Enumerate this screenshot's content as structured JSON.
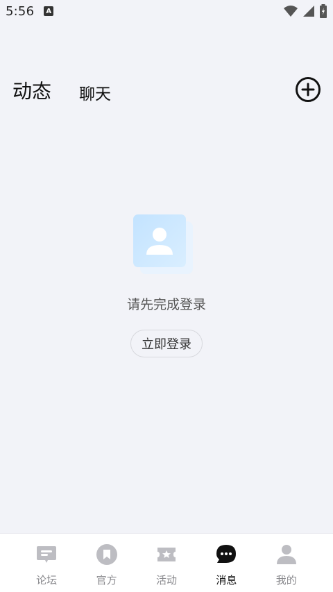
{
  "status_bar": {
    "time": "5:56",
    "badge": "A"
  },
  "header": {
    "tabs": [
      {
        "label": "动态",
        "active": true
      },
      {
        "label": "聊天",
        "active": false
      }
    ],
    "add_icon": "plus-circle-icon"
  },
  "empty_state": {
    "illustration": "user-card-icon",
    "message": "请先完成登录",
    "login_button": "立即登录"
  },
  "bottom_nav": {
    "items": [
      {
        "label": "论坛",
        "icon": "forum-icon",
        "active": false
      },
      {
        "label": "官方",
        "icon": "bookmark-icon",
        "active": false
      },
      {
        "label": "活动",
        "icon": "ticket-star-icon",
        "active": false
      },
      {
        "label": "消息",
        "icon": "chat-bubble-icon",
        "active": true
      },
      {
        "label": "我的",
        "icon": "person-icon",
        "active": false
      }
    ]
  },
  "colors": {
    "background": "#f2f3f8",
    "accent_light": "#c9e6ff",
    "text_dark": "#111111",
    "text_muted": "#8a8a8e"
  }
}
